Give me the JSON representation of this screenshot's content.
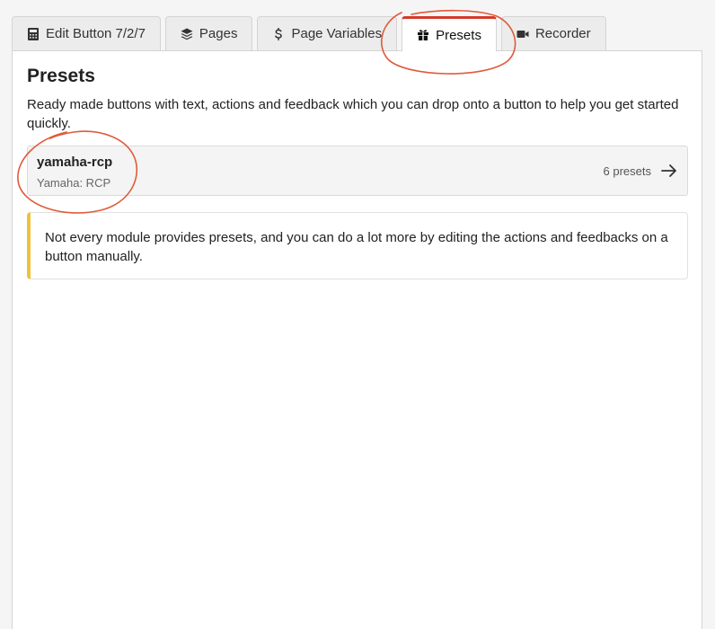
{
  "tabs": [
    {
      "label": "Edit Button 7/2/7",
      "icon": "calculator-icon",
      "active": false
    },
    {
      "label": "Pages",
      "icon": "layers-icon",
      "active": false
    },
    {
      "label": "Page Variables",
      "icon": "dollar-icon",
      "active": false
    },
    {
      "label": "Presets",
      "icon": "gift-icon",
      "active": true
    },
    {
      "label": "Recorder",
      "icon": "video-camera-icon",
      "active": false
    }
  ],
  "presets": {
    "title": "Presets",
    "description": "Ready made buttons with text, actions and feedback which you can drop onto a button to help you get started quickly.",
    "modules": [
      {
        "name": "yamaha-rcp",
        "label": "Yamaha: RCP",
        "count": "6 presets",
        "icon": "arrow-right-icon"
      }
    ],
    "note": "Not every module provides presets, and you can do a lot more by editing the actions and feedbacks on a button manually."
  },
  "colors": {
    "active_tab_accent": "#d43a2a",
    "note_accent": "#f0c23b",
    "annotation": "#e05a3a"
  }
}
